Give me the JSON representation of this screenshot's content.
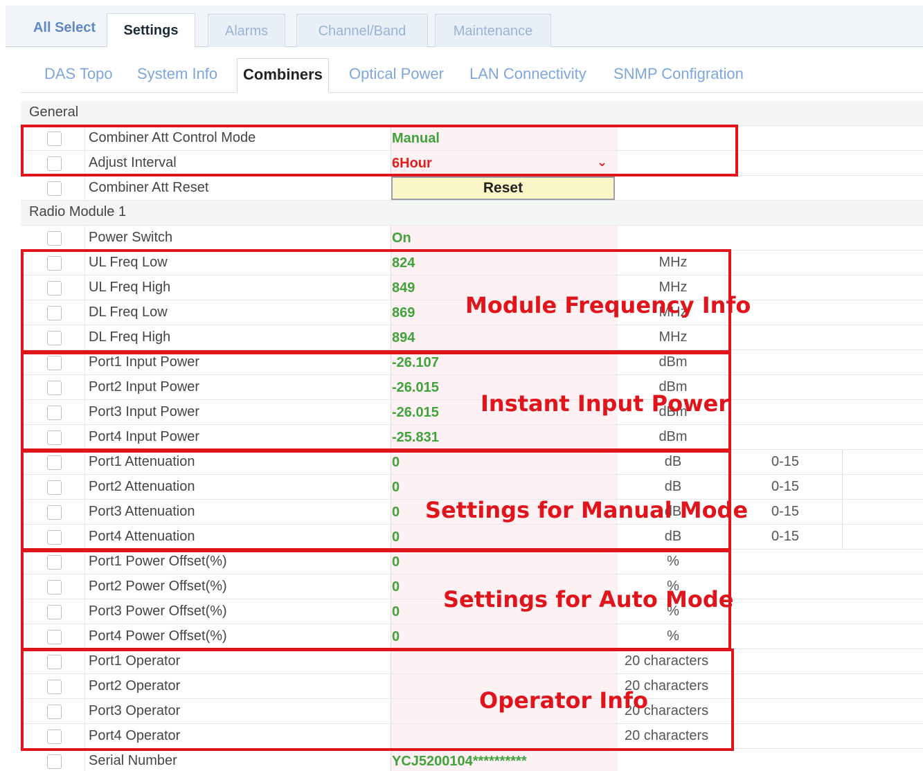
{
  "top_tabs": {
    "all_select": "All Select",
    "settings": "Settings",
    "alarms": "Alarms",
    "channel_band": "Channel/Band",
    "maintenance": "Maintenance"
  },
  "sub_tabs": [
    "DAS Topo",
    "System Info",
    "Combiners",
    "Optical Power",
    "LAN Connectivity",
    "SNMP Configration"
  ],
  "sections": {
    "general": "General",
    "radio_module": "Radio Module 1"
  },
  "rows": [
    {
      "name": "Combiner Att Control Mode",
      "value": "Manual"
    },
    {
      "name": "Adjust Interval",
      "value": "6Hour"
    },
    {
      "name": "Combiner Att Reset",
      "button": "Reset"
    },
    {
      "name": "Power Switch",
      "value": "On"
    },
    {
      "name": "UL Freq Low",
      "value": "824",
      "unit": "MHz"
    },
    {
      "name": "UL Freq High",
      "value": "849",
      "unit": "MHz"
    },
    {
      "name": "DL Freq Low",
      "value": "869",
      "unit": "MHz"
    },
    {
      "name": "DL Freq High",
      "value": "894",
      "unit": "MHz"
    },
    {
      "name": "Port1 Input Power",
      "value": "-26.107",
      "unit": "dBm"
    },
    {
      "name": "Port2 Input Power",
      "value": "-26.015",
      "unit": "dBm"
    },
    {
      "name": "Port3 Input Power",
      "value": "-26.015",
      "unit": "dBm"
    },
    {
      "name": "Port4 Input Power",
      "value": "-25.831",
      "unit": "dBm"
    },
    {
      "name": "Port1 Attenuation",
      "value": "0",
      "unit": "dB",
      "range": "0-15"
    },
    {
      "name": "Port2 Attenuation",
      "value": "0",
      "unit": "dB",
      "range": "0-15"
    },
    {
      "name": "Port3 Attenuation",
      "value": "0",
      "unit": "dB",
      "range": "0-15"
    },
    {
      "name": "Port4 Attenuation",
      "value": "0",
      "unit": "dB",
      "range": "0-15"
    },
    {
      "name": "Port1 Power Offset(%)",
      "value": "0",
      "unit": "%"
    },
    {
      "name": "Port2 Power Offset(%)",
      "value": "0",
      "unit": "%"
    },
    {
      "name": "Port3 Power Offset(%)",
      "value": "0",
      "unit": "%"
    },
    {
      "name": "Port4 Power Offset(%)",
      "value": "0",
      "unit": "%"
    },
    {
      "name": "Port1 Operator",
      "value": "",
      "unit": "20 characters"
    },
    {
      "name": "Port2 Operator",
      "value": "",
      "unit": "20 characters"
    },
    {
      "name": "Port3 Operator",
      "value": "",
      "unit": "20 characters"
    },
    {
      "name": "Port4 Operator",
      "value": "",
      "unit": "20 characters"
    },
    {
      "name": "Serial Number",
      "value": "YCJ5200104**********"
    }
  ],
  "annotations": {
    "module_frequency": "Module Frequency Info",
    "instant_input_power": "Instant Input Power",
    "manual_mode": "Settings for Manual Mode",
    "auto_mode": "Settings for Auto Mode",
    "operator_info": "Operator Info"
  },
  "colors": {
    "annotation": "#e0151c",
    "value_green": "#3fa23a",
    "value_red": "#e02020",
    "link_blue": "#7ea6da"
  }
}
